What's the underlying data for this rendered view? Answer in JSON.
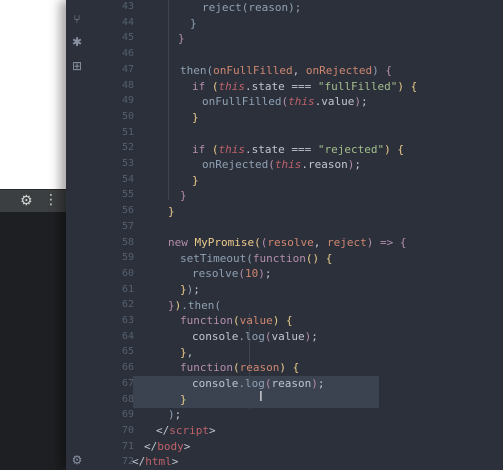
{
  "background_window": {
    "toolbar_icons": [
      "gear-icon",
      "more-vertical-icon"
    ],
    "gear_glyph": "⚙",
    "dots_glyph": "⋮"
  },
  "activity_bar": {
    "icons": [
      "source-control-icon",
      "debug-icon",
      "extensions-icon",
      "settings-icon"
    ]
  },
  "editor": {
    "line_numbers": [
      "43",
      "44",
      "45",
      "46",
      "47",
      "48",
      "49",
      "50",
      "51",
      "52",
      "53",
      "54",
      "55",
      "56",
      "57",
      "58",
      "59",
      "60",
      "61",
      "62",
      "63",
      "64",
      "65",
      "66",
      "67",
      "68",
      "69",
      "70",
      "71",
      "72"
    ],
    "code": {
      "l43": "reject(reason);",
      "l47_then": "then",
      "l47_p1": "onFullFilled",
      "l47_p2": "onRejected",
      "if": "if",
      "this": "this",
      "state": ".state === ",
      "str_full": "\"fullFilled\"",
      "str_rej": "\"rejected\"",
      "value": ".value",
      "reason": ".reason",
      "onFull_call": "onFullFilled",
      "onRej_call": "onRejected",
      "new": "new",
      "MyPromise": "MyPromise",
      "resolve": "resolve",
      "reject": "reject",
      "arrow": "=>",
      "setTimeout": "setTimeout",
      "function": "function",
      "resolve_call": "resolve",
      "ten": "10",
      "then_chain": ".then(",
      "value_p": "value",
      "reason_p": "reason",
      "console": "console",
      "log": ".log",
      "script_close": "script",
      "body_close": "body",
      "html_close": "html"
    }
  }
}
